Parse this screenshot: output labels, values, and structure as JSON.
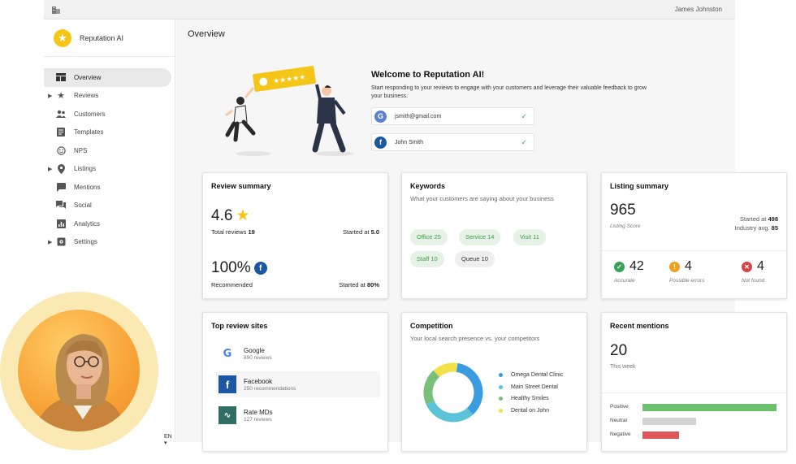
{
  "topbar": {
    "user_name": "James Johnston"
  },
  "sidebar": {
    "brand": "Reputation AI",
    "items": [
      {
        "label": "Overview",
        "icon": "overview-icon",
        "active": true,
        "expandable": false
      },
      {
        "label": "Reviews",
        "icon": "star-icon",
        "active": false,
        "expandable": true
      },
      {
        "label": "Customers",
        "icon": "people-icon",
        "active": false,
        "expandable": false
      },
      {
        "label": "Templates",
        "icon": "template-icon",
        "active": false,
        "expandable": false
      },
      {
        "label": "NPS",
        "icon": "smiley-icon",
        "active": false,
        "expandable": false
      },
      {
        "label": "Listings",
        "icon": "pin-icon",
        "active": false,
        "expandable": true
      },
      {
        "label": "Mentions",
        "icon": "chat-bubble-icon",
        "active": false,
        "expandable": false
      },
      {
        "label": "Social",
        "icon": "forum-icon",
        "active": false,
        "expandable": false
      },
      {
        "label": "Analytics",
        "icon": "bar-chart-icon",
        "active": false,
        "expandable": false
      },
      {
        "label": "Settings",
        "icon": "gear-icon",
        "active": false,
        "expandable": true
      }
    ],
    "language": "EN"
  },
  "main": {
    "title": "Overview",
    "welcome": {
      "title": "Welcome to Reputation AI!",
      "text": "Start responding to your reviews to engage with your customers and leverage their valuable feedback to grow your business.",
      "accounts": [
        {
          "label": "jsmith@gmail.com",
          "icon": "google-business-icon",
          "color": "#5b7fd6"
        },
        {
          "label": "John Smith",
          "icon": "facebook-icon",
          "color": "#1b57a4"
        }
      ]
    },
    "review_summary": {
      "title": "Review summary",
      "rating": "4.6",
      "total_label": "Total reviews",
      "total_value": "19",
      "started_label": "Started at",
      "started_value": "5.0",
      "recommended_pct": "100%",
      "recommended_label": "Recommended",
      "started2_label": "Started at",
      "started2_value": "80%"
    },
    "keywords": {
      "title": "Keywords",
      "subtitle": "What your customers are saying about your business",
      "chips": [
        {
          "label": "Office",
          "count": "25",
          "tone": "green"
        },
        {
          "label": "Service",
          "count": "14",
          "tone": "green"
        },
        {
          "label": "Visit",
          "count": "11",
          "tone": "green"
        },
        {
          "label": "Staff",
          "count": "10",
          "tone": "green"
        },
        {
          "label": "Queue",
          "count": "10",
          "tone": "grey"
        }
      ]
    },
    "listing_summary": {
      "title": "Listing summary",
      "score": "965",
      "score_label": "Listing Score",
      "started_label": "Started at",
      "started_value": "498",
      "industry_label": "Industry avg.",
      "industry_value": "85",
      "stats": [
        {
          "value": "42",
          "label": "Accurate",
          "icon": "check-circle-icon",
          "color": "#3aa05a"
        },
        {
          "value": "4",
          "label": "Possible errors",
          "icon": "warning-icon",
          "color": "#f0a020"
        },
        {
          "value": "4",
          "label": "Not found",
          "icon": "error-x-icon",
          "color": "#d64545"
        }
      ]
    },
    "top_sites": {
      "title": "Top review sites",
      "sites": [
        {
          "name": "Google",
          "count": "890 reviews",
          "icon": "google-icon"
        },
        {
          "name": "Facebook",
          "count": "250 recommendations",
          "icon": "facebook-icon"
        },
        {
          "name": "Rate MDs",
          "count": "127 reviews",
          "icon": "ratemds-icon"
        }
      ]
    },
    "competition": {
      "title": "Competition",
      "subtitle": "Your local search presence vs. your competitors",
      "legend": [
        {
          "name": "Omega Dental Clinic",
          "color": "#3a9be0"
        },
        {
          "name": "Main Street Dental",
          "color": "#5cc4d9"
        },
        {
          "name": "Healthy Smiles",
          "color": "#79c07a"
        },
        {
          "name": "Dental on John",
          "color": "#f3e14a"
        }
      ],
      "donut_shares": [
        0.36,
        0.3,
        0.2,
        0.14
      ]
    },
    "recent_mentions": {
      "title": "Recent mentions",
      "count": "20",
      "period": "This week",
      "bars": [
        {
          "label": "Positive",
          "share": 1.0,
          "color": "#6cc06c"
        },
        {
          "label": "Neutral",
          "share": 0.4,
          "color": "#d4d4d4"
        },
        {
          "label": "Negative",
          "share": 0.27,
          "color": "#e05555"
        }
      ]
    }
  }
}
